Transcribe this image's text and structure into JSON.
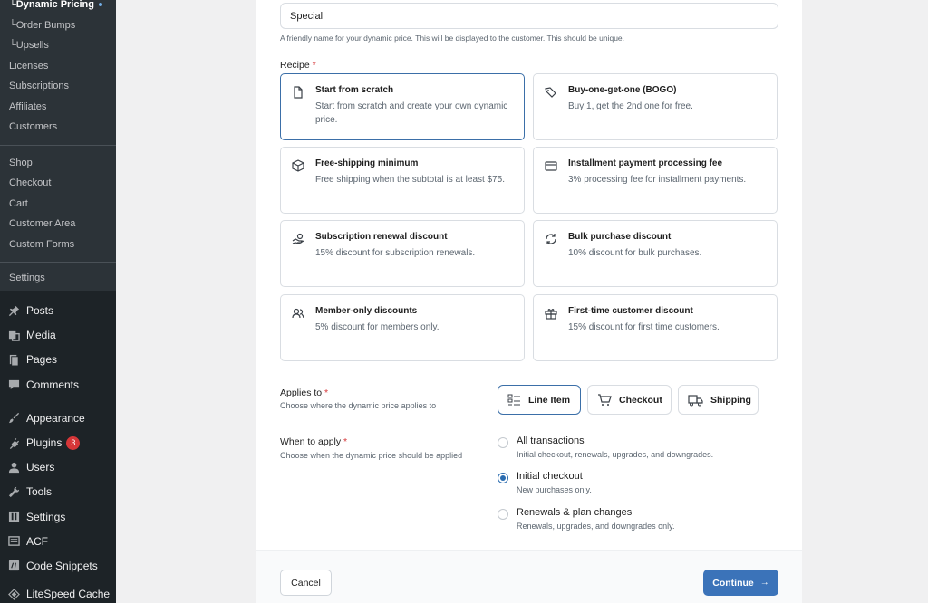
{
  "sidebar": {
    "submenu": [
      {
        "label": "Dynamic Pricing",
        "prefix": "└ ",
        "current": true
      },
      {
        "label": "Order Bumps",
        "prefix": "└ "
      },
      {
        "label": "Upsells",
        "prefix": "└ "
      },
      {
        "label": "Licenses"
      },
      {
        "label": "Subscriptions"
      },
      {
        "label": "Affiliates"
      },
      {
        "label": "Customers"
      },
      {
        "label": "Shop"
      },
      {
        "label": "Checkout"
      },
      {
        "label": "Cart"
      },
      {
        "label": "Customer Area"
      },
      {
        "label": "Custom Forms"
      },
      {
        "label": "Settings"
      }
    ],
    "menu": [
      {
        "label": "Posts",
        "icon": "pin-icon"
      },
      {
        "label": "Media",
        "icon": "media-icon"
      },
      {
        "label": "Pages",
        "icon": "pages-icon"
      },
      {
        "label": "Comments",
        "icon": "comments-icon"
      },
      {
        "label": "Appearance",
        "icon": "brush-icon"
      },
      {
        "label": "Plugins",
        "icon": "plugin-icon",
        "badge": "3"
      },
      {
        "label": "Users",
        "icon": "user-icon"
      },
      {
        "label": "Tools",
        "icon": "wrench-icon"
      },
      {
        "label": "Settings",
        "icon": "settings-icon"
      },
      {
        "label": "ACF",
        "icon": "acf-icon"
      },
      {
        "label": "Code Snippets",
        "icon": "code-icon"
      },
      {
        "label": "LiteSpeed Cache",
        "icon": "diamond-icon"
      }
    ]
  },
  "form": {
    "name_value": "Special",
    "name_help": "A friendly name for your dynamic price. This will be displayed to the customer. This should be unique.",
    "recipe_label": "Recipe",
    "required_mark": "*",
    "recipes": [
      {
        "title": "Start from scratch",
        "desc": "Start from scratch and create your own dynamic price.",
        "icon": "document-icon",
        "selected": true
      },
      {
        "title": "Buy-one-get-one (BOGO)",
        "desc": "Buy 1, get the 2nd one for free.",
        "icon": "tags-icon"
      },
      {
        "title": "Free-shipping minimum",
        "desc": "Free shipping when the subtotal is at least $75.",
        "icon": "package-icon"
      },
      {
        "title": "Installment payment processing fee",
        "desc": "3% processing fee for installment payments.",
        "icon": "credit-card-icon"
      },
      {
        "title": "Subscription renewal discount",
        "desc": "15% discount for subscription renewals.",
        "icon": "hand-coins-icon"
      },
      {
        "title": "Bulk purchase discount",
        "desc": "10% discount for bulk purchases.",
        "icon": "refresh-icon"
      },
      {
        "title": "Member-only discounts",
        "desc": "5% discount for members only.",
        "icon": "users-icon"
      },
      {
        "title": "First-time customer discount",
        "desc": "15% discount for first time customers.",
        "icon": "gift-icon"
      }
    ],
    "applies_label": "Applies to",
    "applies_help": "Choose where the dynamic price applies to",
    "applies_options": [
      {
        "label": "Line Item",
        "icon": "list-icon",
        "selected": true
      },
      {
        "label": "Checkout",
        "icon": "cart-icon"
      },
      {
        "label": "Shipping",
        "icon": "truck-icon"
      }
    ],
    "when_label": "When to apply",
    "when_help": "Choose when the dynamic price should be applied",
    "when_options": [
      {
        "title": "All transactions",
        "desc": "Initial checkout, renewals, upgrades, and downgrades.",
        "checked": false
      },
      {
        "title": "Initial checkout",
        "desc": "New purchases only.",
        "checked": true
      },
      {
        "title": "Renewals & plan changes",
        "desc": "Renewals, upgrades, and downgrades only.",
        "checked": false
      }
    ]
  },
  "footer": {
    "cancel_label": "Cancel",
    "continue_label": "Continue",
    "continue_arrow": "→"
  }
}
